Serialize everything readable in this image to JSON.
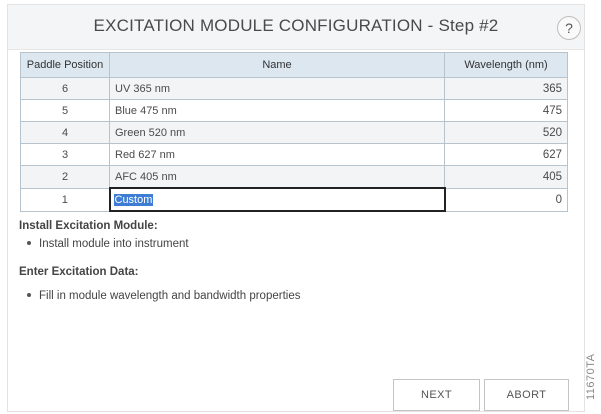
{
  "dialog": {
    "title": "EXCITATION MODULE CONFIGURATION - Step #2",
    "help_label": "?"
  },
  "table": {
    "columns": [
      "Paddle Position",
      "Name",
      "Wavelength (nm)"
    ],
    "rows": [
      {
        "position": "6",
        "name": "UV 365 nm",
        "wavelength": "365"
      },
      {
        "position": "5",
        "name": "Blue 475 nm",
        "wavelength": "475"
      },
      {
        "position": "4",
        "name": "Green 520 nm",
        "wavelength": "520"
      },
      {
        "position": "3",
        "name": "Red 627 nm",
        "wavelength": "627"
      },
      {
        "position": "2",
        "name": "AFC 405 nm",
        "wavelength": "405"
      },
      {
        "position": "1",
        "name": "Custom",
        "wavelength": "0"
      }
    ]
  },
  "instructions": {
    "install_title": "Install Excitation Module:",
    "install_bullet": "Install module into instrument",
    "enter_title": "Enter Excitation Data:",
    "enter_bullet": "Fill in module wavelength and bandwidth properties"
  },
  "buttons": {
    "next": "NEXT",
    "abort": "ABORT"
  },
  "figure_id": "11670TA"
}
